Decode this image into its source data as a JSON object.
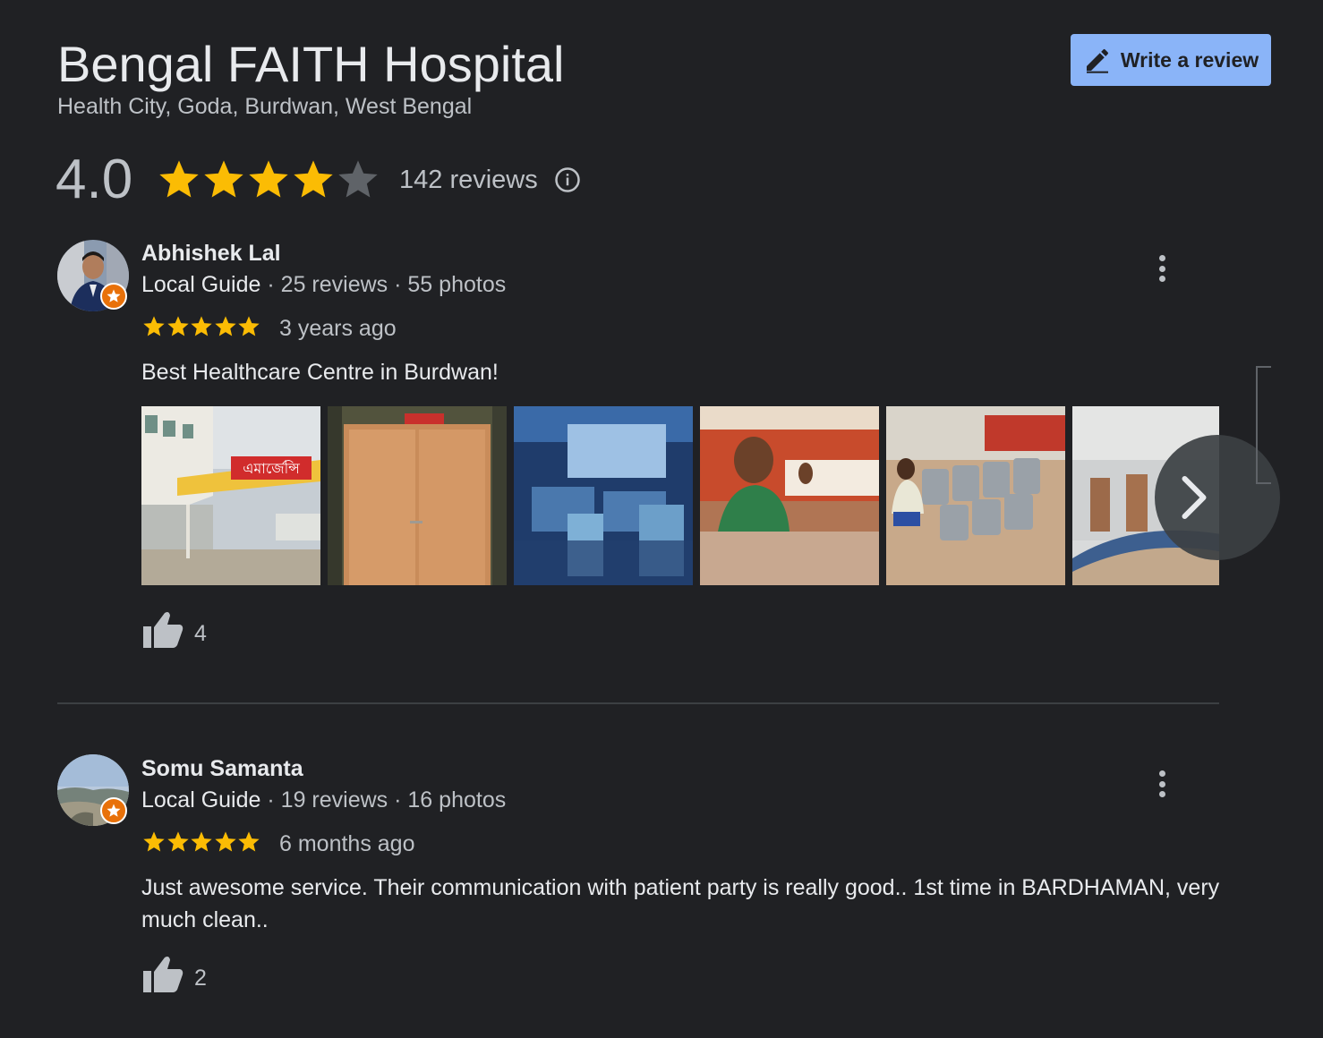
{
  "place": {
    "name": "Bengal FAITH Hospital",
    "address": "Health City, Goda, Burdwan, West Bengal"
  },
  "write_review": {
    "label": "Write a review",
    "icon": "pencil-icon"
  },
  "rating": {
    "value": "4.0",
    "stars": 4,
    "max_stars": 5,
    "review_count": "142 reviews",
    "info_icon": "info-icon"
  },
  "colors": {
    "background": "#202124",
    "star_filled": "#fbbc04",
    "star_empty": "#5f6368",
    "button": "#8ab4f8",
    "badge": "#e8710a"
  },
  "reviews": [
    {
      "name": "Abhishek Lal",
      "badge": "Local Guide",
      "reviews": "25 reviews",
      "photos": "55 photos",
      "stars": 5,
      "time": "3 years ago",
      "text": "Best Healthcare Centre in Burdwan!",
      "likes": "4",
      "photo_sign_text": "এমার্জেন্সি",
      "photo_descriptions": [
        "hospital-entrance",
        "wooden-door",
        "ward-beds",
        "man-gesturing",
        "waiting-chairs",
        "hallway-floor"
      ]
    },
    {
      "name": "Somu Samanta",
      "badge": "Local Guide",
      "reviews": "19 reviews",
      "photos": "16 photos",
      "stars": 5,
      "time": "6 months ago",
      "text": "Just awesome service. Their communication with patient party is really good.. 1st time in BARDHAMAN, very much clean..",
      "likes": "2"
    }
  ]
}
